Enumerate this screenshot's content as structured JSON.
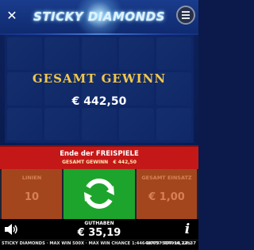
{
  "game": {
    "logo_text": "STICKY DIAMONDS",
    "win_title": "GESAMT GEWINN",
    "win_amount": "€ 442,50"
  },
  "banner": {
    "title": "Ende der FREISPIELE",
    "sub_label": "GESAMT GEWINN",
    "sub_amount": "€ 442,50"
  },
  "controls": {
    "lines_label": "LINIEN",
    "lines_value": "10",
    "total_bet_label": "GESAMT EINSATZ",
    "total_bet_value": "€ 1,00",
    "balance_label": "GUTHABEN",
    "balance_value": "€ 35,19"
  },
  "status": {
    "left_text": "STICKY DIAMONDS · MAX WIN 500X · MAX WIN CHANCE 1:44644779 · RTP 96,22%",
    "right_text": "16657514914 14:37"
  },
  "icons": {
    "close": "close-icon",
    "menu": "hamburger-menu-icon",
    "spin": "refresh-arrows-icon",
    "sound": "speaker-icon",
    "info": "info-icon"
  },
  "colors": {
    "banner_red": "#c41818",
    "spin_green": "#1da42c",
    "side_orange": "#a3461e",
    "win_gold": "#f2c84a"
  }
}
